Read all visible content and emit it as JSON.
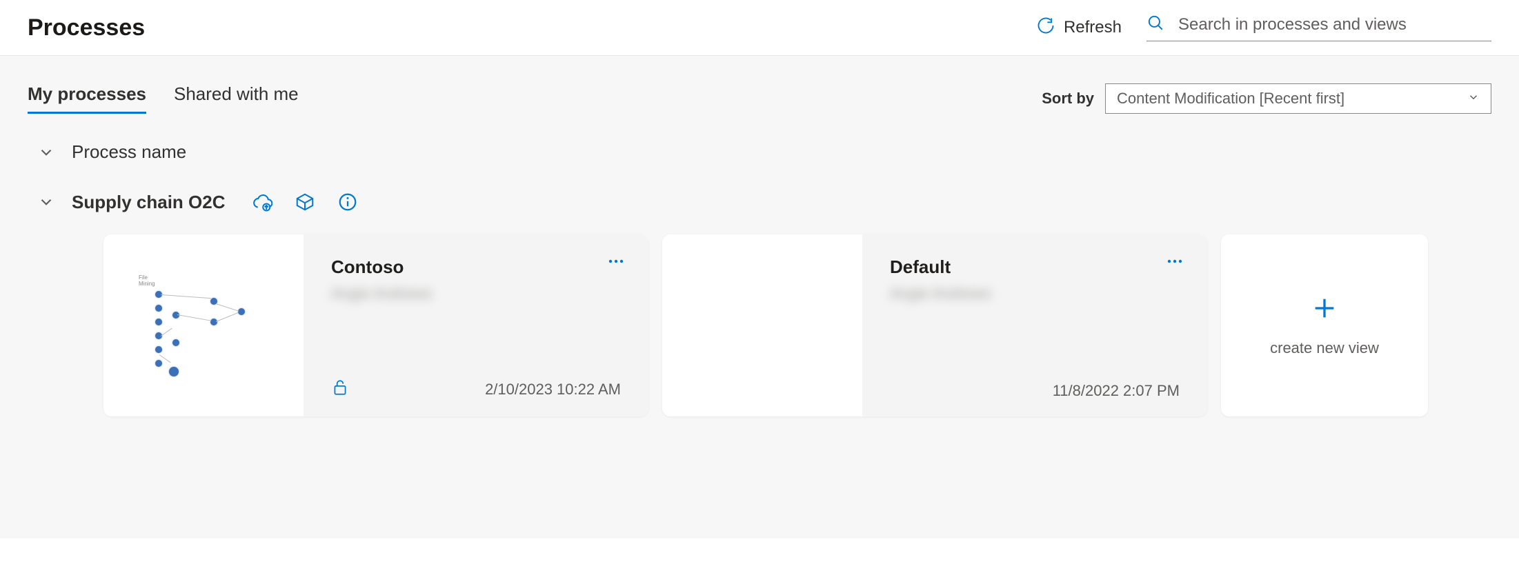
{
  "header": {
    "title": "Processes",
    "refresh_label": "Refresh",
    "search_placeholder": "Search in processes and views"
  },
  "tabs": {
    "my_processes": "My processes",
    "shared_with_me": "Shared with me"
  },
  "sort": {
    "label": "Sort by",
    "value": "Content Modification [Recent first]"
  },
  "groups_header": "Process name",
  "group": {
    "name": "Supply chain O2C"
  },
  "cards": [
    {
      "title": "Contoso",
      "owner": "Angie Andrews",
      "date": "2/10/2023 10:22 AM",
      "locked": true
    },
    {
      "title": "Default",
      "owner": "Angie Andrews",
      "date": "11/8/2022 2:07 PM",
      "locked": false
    }
  ],
  "new_view_label": "create new view"
}
